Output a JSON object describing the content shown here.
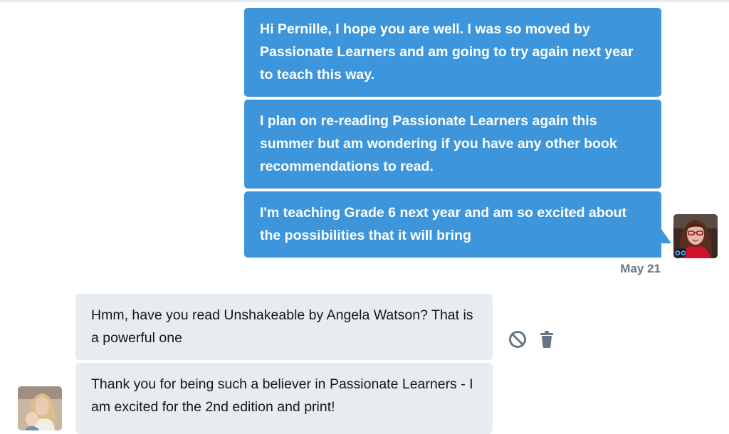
{
  "conversation": {
    "sent_messages": [
      {
        "text": "Hi Pernille, I hope you are well. I was so moved by Passionate Learners and am going to try again next year to teach this way."
      },
      {
        "text": "I plan on re-reading Passionate Learners again this summer but am wondering if you have any other book recommendations to read."
      },
      {
        "text": "I'm teaching Grade 6 next year and am so excited about the possibilities that it will bring"
      }
    ],
    "sent_timestamp": "May 21",
    "received_messages": [
      {
        "text": "Hmm, have you read Unshakeable by Angela Watson? That is a powerful one"
      },
      {
        "text": "Thank you for being such a believer in Passionate Learners - I am excited for the 2nd edition and print!"
      }
    ]
  },
  "icons": {
    "block": "block-icon",
    "delete": "trash-icon"
  },
  "colors": {
    "sent_bubble": "#3d95db",
    "received_bubble": "#e6ecf0",
    "timestamp": "#657786",
    "icon": "#657786"
  }
}
